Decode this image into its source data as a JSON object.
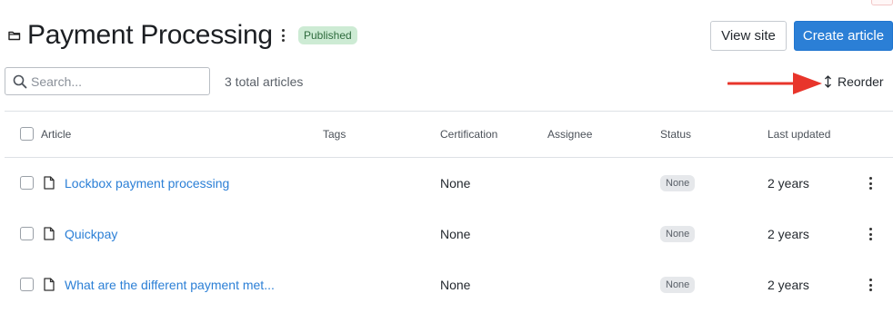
{
  "header": {
    "title": "Payment Processing",
    "badge": "Published",
    "view_site_label": "View site",
    "create_article_label": "Create article"
  },
  "search": {
    "placeholder": "Search...",
    "value": ""
  },
  "summary": {
    "total_articles": "3 total articles"
  },
  "reorder_label": "Reorder",
  "table": {
    "columns": [
      "Article",
      "Tags",
      "Certification",
      "Assignee",
      "Status",
      "Last updated"
    ],
    "rows": [
      {
        "article": "Lockbox payment processing",
        "tags": "",
        "certification": "None",
        "assignee": "",
        "status": "None",
        "last_updated": "2 years"
      },
      {
        "article": "Quickpay",
        "tags": "",
        "certification": "None",
        "assignee": "",
        "status": "None",
        "last_updated": "2 years"
      },
      {
        "article": "What are the different payment met...",
        "tags": "",
        "certification": "None",
        "assignee": "",
        "status": "None",
        "last_updated": "2 years"
      }
    ]
  },
  "colors": {
    "primary_button": "#2b7fd6",
    "link": "#2b7fd6",
    "published_badge_bg": "#cdebd4",
    "annotation_arrow": "#e8352b"
  },
  "icons": [
    "folder-icon",
    "kebab-menu-icon",
    "search-icon",
    "reorder-arrows-icon",
    "document-icon",
    "annotation-arrow"
  ]
}
